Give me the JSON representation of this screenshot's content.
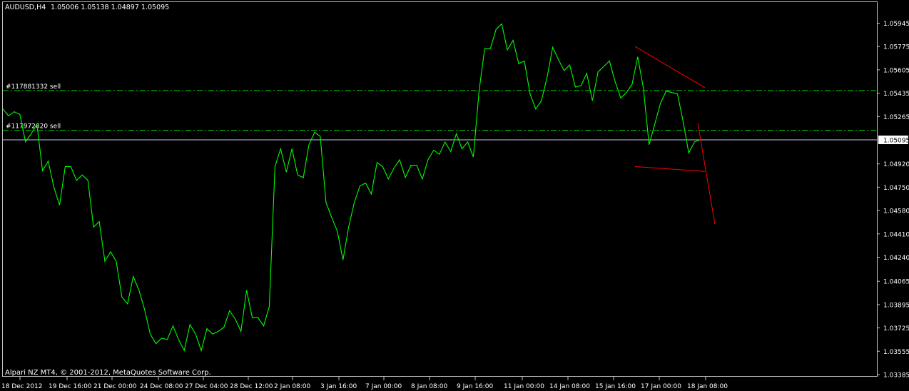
{
  "header": {
    "symbol": "AUDUSD,H4",
    "ohlc": "1.05006 1.05138 1.04897 1.05095"
  },
  "footer": {
    "copyright": "Alpari NZ MT4, © 2001-2012, MetaQuotes Software Corp."
  },
  "colors": {
    "background": "#000000",
    "frame": "#c0c0c0",
    "price_line": "#00ff00",
    "order_line": "#00c800",
    "bid_line": "#c8c8e8",
    "trendline": "#ff0000",
    "text": "#ffffff"
  },
  "chart_data": {
    "type": "line",
    "title": "AUDUSD,H4",
    "grid": false,
    "ylim": [
      1.0338,
      1.0602
    ],
    "y_ticks": [
      "1.05945",
      "1.05775",
      "1.05605",
      "1.05435",
      "1.05265",
      "1.04920",
      "1.04750",
      "1.04580",
      "1.04410",
      "1.04240",
      "1.04065",
      "1.03895",
      "1.03725",
      "1.03555",
      "1.03385"
    ],
    "x_ticks": [
      "18 Dec 2012",
      "19 Dec 16:00",
      "21 Dec 00:00",
      "24 Dec 08:00",
      "27 Dec 04:00",
      "28 Dec 12:00",
      "2 Jan 08:00",
      "3 Jan 16:00",
      "7 Jan 00:00",
      "8 Jan 08:00",
      "9 Jan 16:00",
      "11 Jan 00:00",
      "14 Jan 08:00",
      "15 Jan 16:00",
      "17 Jan 00:00",
      "18 Jan 08:00"
    ],
    "current_price": {
      "value": 1.05095,
      "label": "1.05095"
    },
    "order_lines": [
      {
        "label": "#117881332 sell",
        "price": 1.05455
      },
      {
        "label": "#117972820 sell",
        "price": 1.05165
      }
    ],
    "close_series": [
      1.0532,
      1.0527,
      1.053,
      1.0528,
      1.0508,
      1.0514,
      1.0521,
      1.0487,
      1.0494,
      1.0475,
      1.0462,
      1.049,
      1.049,
      1.048,
      1.0484,
      1.048,
      1.0446,
      1.045,
      1.0421,
      1.0428,
      1.0421,
      1.0395,
      1.039,
      1.041,
      1.04,
      1.0386,
      1.0368,
      1.0361,
      1.0365,
      1.0364,
      1.0374,
      1.0364,
      1.0356,
      1.0375,
      1.0368,
      1.0356,
      1.0372,
      1.0368,
      1.037,
      1.0373,
      1.0385,
      1.0379,
      1.037,
      1.04,
      1.038,
      1.038,
      1.0374,
      1.0388,
      1.049,
      1.0503,
      1.0486,
      1.0503,
      1.0484,
      1.0482,
      1.0506,
      1.0515,
      1.0512,
      1.0464,
      1.0453,
      1.0443,
      1.0422,
      1.0446,
      1.0464,
      1.0476,
      1.0478,
      1.047,
      1.0493,
      1.049,
      1.0481,
      1.0489,
      1.0495,
      1.0482,
      1.0491,
      1.0491,
      1.0481,
      1.0495,
      1.0502,
      1.0499,
      1.0508,
      1.0501,
      1.0514,
      1.0503,
      1.0508,
      1.0497,
      1.0545,
      1.0576,
      1.0576,
      1.059,
      1.0594,
      1.0575,
      1.0582,
      1.0565,
      1.0567,
      1.0543,
      1.0532,
      1.0538,
      1.0555,
      1.0577,
      1.0568,
      1.056,
      1.0564,
      1.0548,
      1.0549,
      1.0558,
      1.0538,
      1.0559,
      1.0563,
      1.0567,
      1.0552,
      1.054,
      1.0544,
      1.055,
      1.057,
      1.0547,
      1.0506,
      1.0521,
      1.0536,
      1.0545,
      1.0544,
      1.0543,
      1.0523,
      1.05,
      1.0508,
      1.05095
    ],
    "trendlines": [
      {
        "color": "#ff0000",
        "from": {
          "date": "17 Jan 00:00",
          "price": 1.05775
        },
        "to": {
          "date": "18 Jan 20:00",
          "price": 1.05475
        }
      },
      {
        "color": "#ff0000",
        "from": {
          "date": "17 Jan 00:00",
          "price": 1.049
        },
        "to": {
          "date": "18 Jan 20:00",
          "price": 1.04865
        }
      },
      {
        "color": "#ff0000",
        "from": {
          "date": "18 Jan 16:00",
          "price": 1.05215
        },
        "to": {
          "date": "19 Jan 00:00",
          "price": 1.0448
        }
      }
    ]
  }
}
